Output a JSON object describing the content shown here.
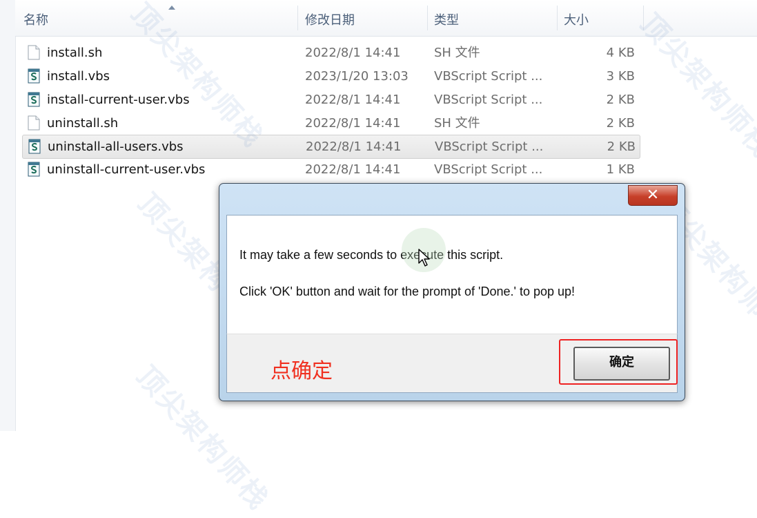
{
  "columns": {
    "name": "名称",
    "date": "修改日期",
    "type": "类型",
    "size": "大小"
  },
  "files": [
    {
      "name": "install.sh",
      "date": "2022/8/1 14:41",
      "type": "SH 文件",
      "size": "4 KB",
      "icon": "blank-file-icon"
    },
    {
      "name": "install.vbs",
      "date": "2023/1/20 13:03",
      "type": "VBScript Script ...",
      "size": "3 KB",
      "icon": "vbscript-file-icon"
    },
    {
      "name": "install-current-user.vbs",
      "date": "2022/8/1 14:41",
      "type": "VBScript Script ...",
      "size": "2 KB",
      "icon": "vbscript-file-icon"
    },
    {
      "name": "uninstall.sh",
      "date": "2022/8/1 14:41",
      "type": "SH 文件",
      "size": "2 KB",
      "icon": "blank-file-icon"
    },
    {
      "name": "uninstall-all-users.vbs",
      "date": "2022/8/1 14:41",
      "type": "VBScript Script ...",
      "size": "2 KB",
      "icon": "vbscript-file-icon",
      "selected": true
    },
    {
      "name": "uninstall-current-user.vbs",
      "date": "2022/8/1 14:41",
      "type": "VBScript Script ...",
      "size": "1 KB",
      "icon": "vbscript-file-icon"
    }
  ],
  "dialog": {
    "close_glyph": "✕",
    "line1": "It may take a few seconds to execute this script.",
    "line2": "Click 'OK' button and wait for the prompt of 'Done.' to pop up!",
    "ok_label": "确定"
  },
  "annotation": "点确定",
  "watermark": "顶尖架构师栈",
  "colors": {
    "highlight": "#ee2222",
    "annotation": "#f03020",
    "close_button": "#c7402a"
  }
}
